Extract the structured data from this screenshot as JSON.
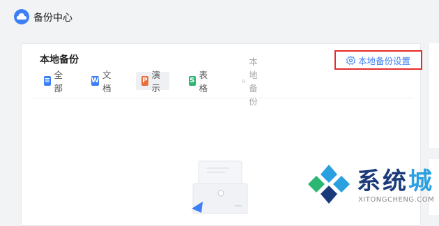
{
  "app": {
    "title": "备份中心",
    "icon": "cloud-icon"
  },
  "panel": {
    "title": "本地备份",
    "tabs": [
      {
        "label": "全部",
        "icon_glyph": "≡",
        "icon_color": "#3d7ff5",
        "icon": "all-files-icon"
      },
      {
        "label": "文档",
        "icon_glyph": "W",
        "icon_color": "#3d7ff5",
        "icon": "word-doc-icon"
      },
      {
        "label": "演示",
        "icon_glyph": "P",
        "icon_color": "#e8703a",
        "icon": "ppt-icon",
        "selected": true
      },
      {
        "label": "表格",
        "icon_glyph": "S",
        "icon_color": "#2bb673",
        "icon": "sheet-icon"
      }
    ],
    "search_placeholder": "本地备份",
    "settings_label": "本地备份设置"
  },
  "watermark": {
    "brand_main": "系统",
    "brand_accent": "城",
    "domain": "XITONGCHENG.COM"
  },
  "colors": {
    "accent": "#3d7ff5",
    "highlight": "#e62b2b",
    "background": "#f2f3f5"
  }
}
